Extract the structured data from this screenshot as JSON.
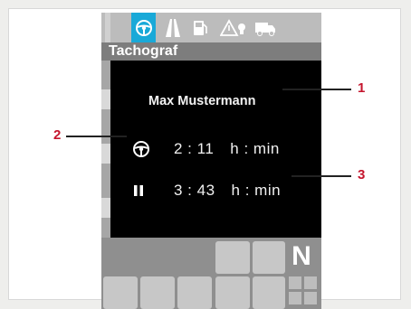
{
  "screen": {
    "title": "Tachograf",
    "tabs": [
      {
        "icon": "steering-wheel-icon",
        "active": true
      },
      {
        "icon": "road-icon",
        "active": false
      },
      {
        "icon": "fuel-pump-icon",
        "active": false
      },
      {
        "icon": "warning-icon",
        "active": false
      },
      {
        "icon": "truck-icon",
        "active": false
      }
    ],
    "driver_name": "Max Mustermann",
    "driving_time": {
      "icon": "steering-wheel-icon",
      "value": "2 : 11",
      "unit": "h : min"
    },
    "rest_time": {
      "icon": "pause-icon",
      "value": "3 : 43",
      "unit": "h : min"
    },
    "gear": "N"
  },
  "callouts": [
    {
      "number": "1",
      "refers_to": "driver_name"
    },
    {
      "number": "2",
      "refers_to": "driving_time"
    },
    {
      "number": "3",
      "refers_to": "rest_time"
    }
  ],
  "colors": {
    "accent_tab": "#19a9d8",
    "callout_red": "#c5152d",
    "panel_bg": "#000000"
  }
}
